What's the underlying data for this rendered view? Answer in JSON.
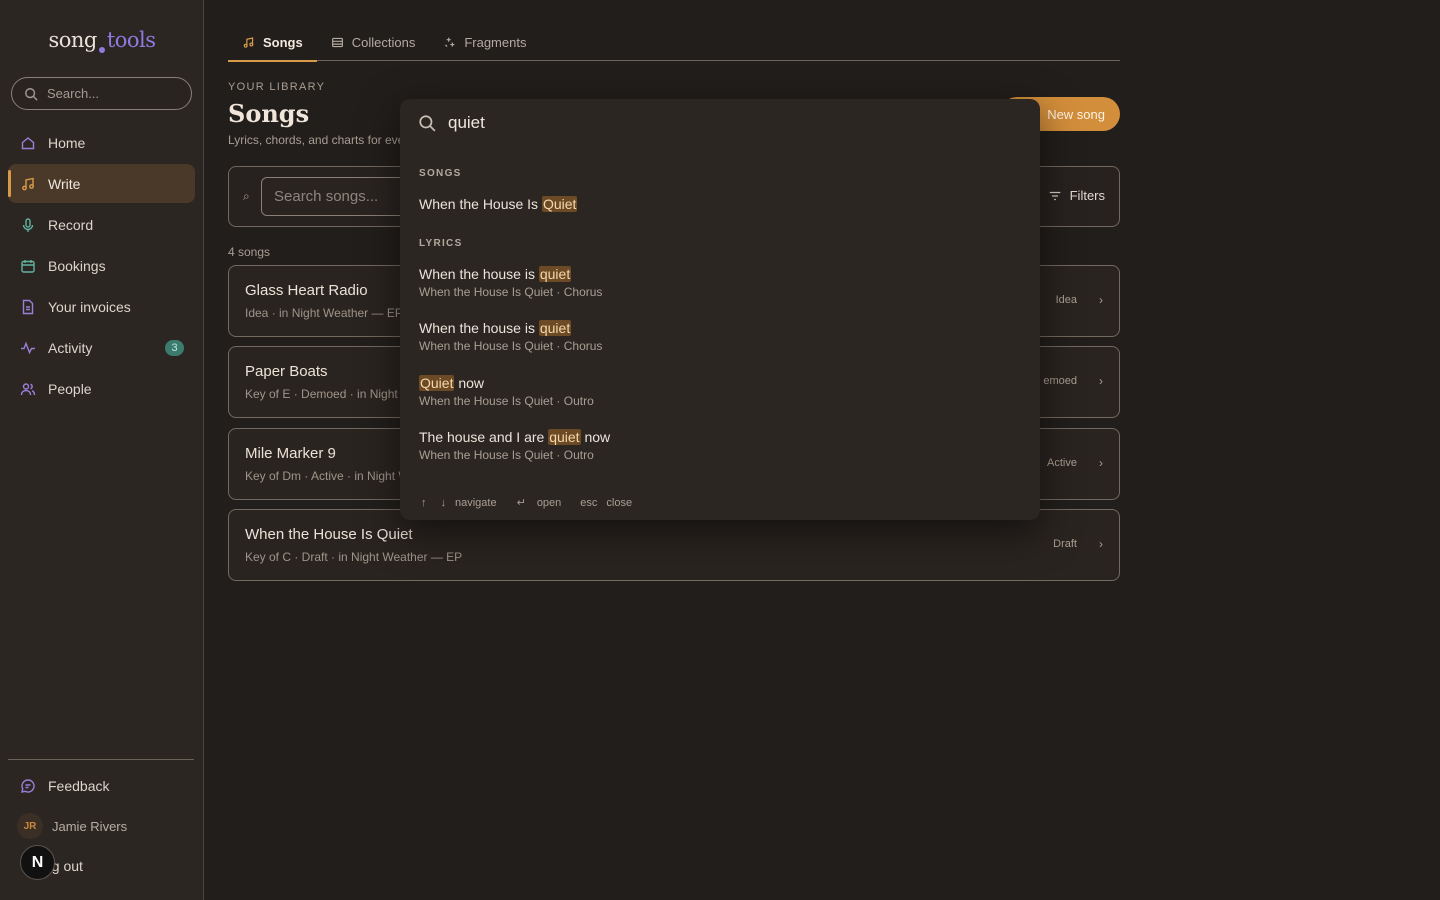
{
  "logo": {
    "part1": "song",
    "part2": "tools"
  },
  "sidebar": {
    "search_placeholder": "Search...",
    "items": [
      {
        "label": "Home",
        "icon": "home-icon"
      },
      {
        "label": "Write",
        "icon": "music-note-icon",
        "active": true
      },
      {
        "label": "Record",
        "icon": "microphone-icon"
      },
      {
        "label": "Bookings",
        "icon": "calendar-icon"
      },
      {
        "label": "Your invoices",
        "icon": "invoice-icon"
      },
      {
        "label": "Activity",
        "icon": "activity-icon",
        "badge": "3"
      },
      {
        "label": "People",
        "icon": "people-icon"
      }
    ],
    "feedback_label": "Feedback",
    "user": {
      "initials": "JR",
      "name": "Jamie Rivers"
    },
    "logout_label": "og out",
    "floating_button": "N"
  },
  "tabs": [
    {
      "label": "Songs",
      "active": true
    },
    {
      "label": "Collections"
    },
    {
      "label": "Fragments"
    }
  ],
  "header": {
    "eyebrow": "YOUR LIBRARY",
    "title": "Songs",
    "subtitle": "Lyrics, chords, and charts for eve",
    "new_button": "New song"
  },
  "toolbar": {
    "search_placeholder": "Search songs...",
    "filters_label": "Filters"
  },
  "song_count": "4 songs",
  "songs": [
    {
      "title": "Glass Heart Radio",
      "meta": "Idea · in Night Weather — EP",
      "status": "Idea"
    },
    {
      "title": "Paper Boats",
      "meta": "Key of E · Demoed · in Night W",
      "status": "emoed"
    },
    {
      "title": "Mile Marker 9",
      "meta": "Key of Dm · Active · in Night W",
      "status": "Active"
    },
    {
      "title": "When the House Is Quiet",
      "meta": "Key of C · Draft · in Night Weather — EP",
      "status": "Draft"
    }
  ],
  "palette": {
    "query": "quiet",
    "songs_heading": "SONGS",
    "song_result": {
      "before": "When the House Is ",
      "match": "Quiet",
      "after": ""
    },
    "lyrics_heading": "LYRICS",
    "lyrics": [
      {
        "before": "When the house is ",
        "match": "quiet",
        "after": "",
        "sub": "When the House Is Quiet · Chorus"
      },
      {
        "before": "When the house is ",
        "match": "quiet",
        "after": "",
        "sub": "When the House Is Quiet · Chorus"
      },
      {
        "before": "",
        "match": "Quiet",
        "after": " now",
        "sub": "When the House Is Quiet · Outro"
      },
      {
        "before": "The house and I are ",
        "match": "quiet",
        "after": " now",
        "sub": "When the House Is Quiet · Outro"
      }
    ],
    "footer": {
      "up_key": "↑",
      "down_key": "↓",
      "navigate": "navigate",
      "enter_key": "↵",
      "open": "open",
      "esc_key": "esc",
      "close": "close"
    }
  },
  "colors": {
    "accent": "#d79a49",
    "logo_purple": "#8f7be0",
    "badge": "#3c7c6f",
    "highlight": "#6b4a25"
  }
}
